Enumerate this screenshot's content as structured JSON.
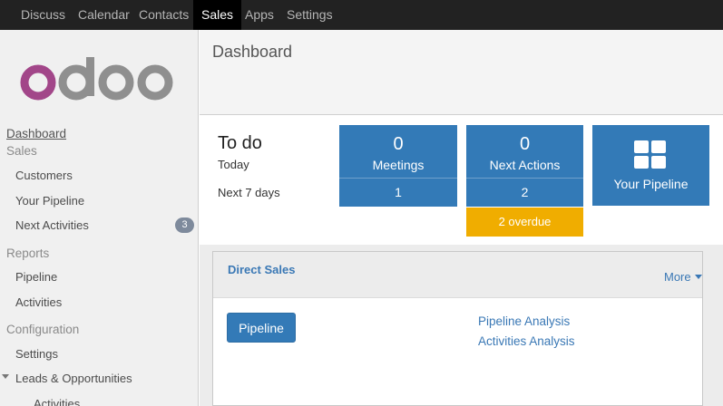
{
  "topbar": {
    "items": [
      "Discuss",
      "Calendar",
      "Contacts",
      "Sales",
      "Apps",
      "Settings"
    ],
    "active": "Sales"
  },
  "sidebar": {
    "logo_text": "odoo",
    "dashboard": "Dashboard",
    "sales_header": "Sales",
    "customers": "Customers",
    "your_pipeline": "Your Pipeline",
    "next_activities": "Next Activities",
    "next_activities_count": "3",
    "reports_header": "Reports",
    "pipeline": "Pipeline",
    "activities": "Activities",
    "configuration_header": "Configuration",
    "settings": "Settings",
    "leads_opportunities": "Leads & Opportunities",
    "leads_activities": "Activities"
  },
  "page": {
    "title": "Dashboard"
  },
  "todo": {
    "title": "To do",
    "today": "Today",
    "next7": "Next 7 days"
  },
  "tiles": {
    "meetings": {
      "today": "0",
      "label": "Meetings",
      "next7": "1"
    },
    "next_actions": {
      "today": "0",
      "label": "Next Actions",
      "next7": "2",
      "overdue": "2 overdue"
    },
    "pipeline": {
      "label": "Your Pipeline"
    }
  },
  "direct_sales": {
    "title": "Direct Sales",
    "more": "More",
    "pipeline_button": "Pipeline",
    "links": [
      "Pipeline Analysis",
      "Activities Analysis"
    ]
  },
  "colors": {
    "tile_blue": "#337ab7",
    "overdue_orange": "#f0ad00",
    "logo_purple": "#a24689",
    "logo_grey": "#8f8f8f"
  }
}
